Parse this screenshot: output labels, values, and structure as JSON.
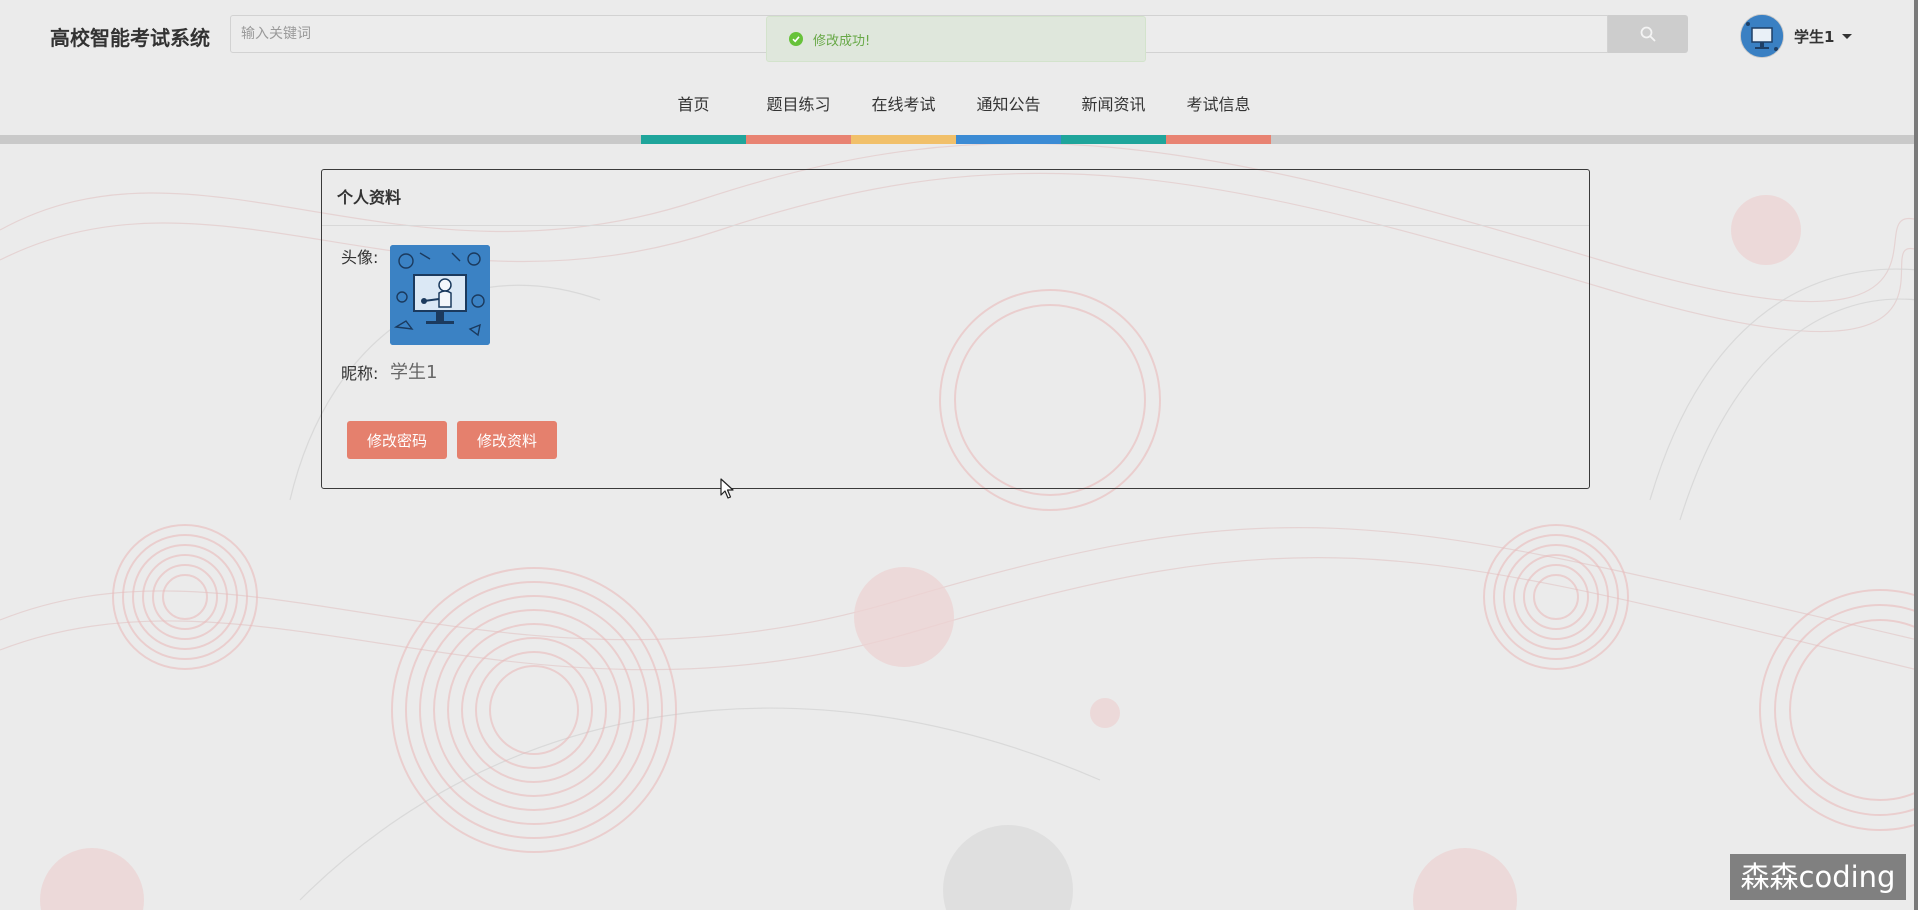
{
  "header": {
    "brand": "高校智能考试系统",
    "search_placeholder": "输入关键词",
    "user_name": "学生1"
  },
  "toast": {
    "message": "修改成功!"
  },
  "nav": {
    "items": [
      {
        "label": "首页",
        "color": "#1fa59b"
      },
      {
        "label": "题目练习",
        "color": "#e88372"
      },
      {
        "label": "在线考试",
        "color": "#f1c06a"
      },
      {
        "label": "通知公告",
        "color": "#3b8bd4"
      },
      {
        "label": "新闻资讯",
        "color": "#1fa59b"
      },
      {
        "label": "考试信息",
        "color": "#e88372"
      }
    ]
  },
  "profile": {
    "title": "个人资料",
    "avatar_label": "头像:",
    "nickname_label": "昵称:",
    "nickname_value": "学生1",
    "change_password_label": "修改密码",
    "edit_profile_label": "修改资料"
  },
  "watermark": "森森coding",
  "icons": {
    "search": "search-icon",
    "success": "check-circle-icon",
    "caret": "caret-down-icon"
  },
  "colors": {
    "accent_button": "#e5806d",
    "toast_text": "#67a846"
  }
}
